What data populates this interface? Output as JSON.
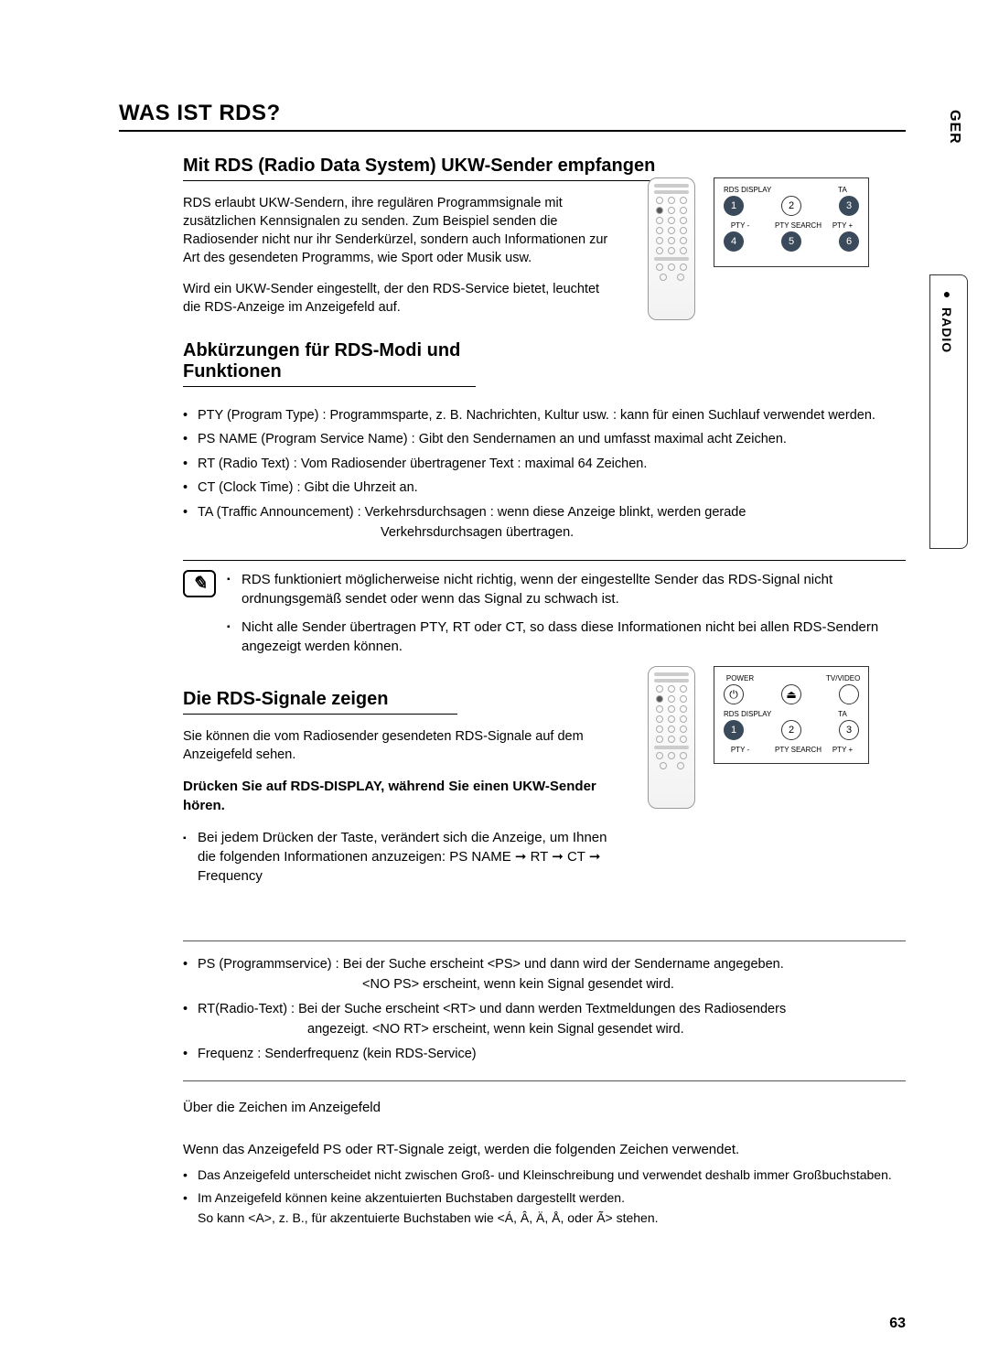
{
  "lang": "GER",
  "sectionTab": "RADIO",
  "pageNumber": "63",
  "title": "WAS IST RDS?",
  "s1": {
    "heading": "Mit RDS (Radio Data System) UKW-Sender empfangen",
    "p1": "RDS erlaubt UKW-Sendern, ihre regulären Programmsignale mit zusätzlichen Kennsignalen zu senden. Zum Beispiel senden die Radiosender nicht nur ihr Senderkürzel, sondern auch Informationen zur Art des gesendeten Programms, wie Sport oder Musik usw.",
    "p2": "Wird ein UKW-Sender eingestellt, der den RDS-Service bietet, leuchtet die RDS-Anzeige im Anzeigefeld auf."
  },
  "s2": {
    "heading": "Abkürzungen für RDS-Modi und Funktionen",
    "b1": "PTY (Program Type) : Programmsparte, z. B. Nachrichten, Kultur usw. : kann für einen Suchlauf verwendet werden.",
    "b2": "PS NAME (Program Service Name) : Gibt den Sendernamen an und umfasst maximal acht Zeichen.",
    "b3": "RT (Radio Text) : Vom Radiosender übertragener Text : maximal 64 Zeichen.",
    "b4": "CT (Clock Time) : Gibt die Uhrzeit an.",
    "b5a": "TA (Traffic Announcement) : Verkehrsdurchsagen : wenn diese Anzeige blinkt, werden gerade",
    "b5b": "Verkehrsdurchsagen übertragen."
  },
  "notes1": {
    "n1": "RDS funktioniert möglicherweise nicht richtig, wenn der eingestellte Sender das RDS-Signal nicht ordnungsgemäß sendet oder wenn das Signal zu schwach ist.",
    "n2": "Nicht alle Sender übertragen PTY, RT oder CT, so dass diese Informationen nicht bei allen RDS-Sendern angezeigt werden können."
  },
  "s3": {
    "heading": "Die RDS-Signale zeigen",
    "p1": "Sie können die vom Radiosender gesendeten RDS-Signale auf dem Anzeigefeld sehen.",
    "bold": "Drücken Sie auf RDS-DISPLAY, während Sie einen UKW-Sender hören.",
    "li1": "Bei jedem Drücken der Taste, verändert sich die An­zeige, um Ihnen die folgenden Informationen anzuzei­gen: PS NAME ➞ RT ➞ CT ➞ Frequency"
  },
  "s4": {
    "b1a": "PS (Programmservice) : Bei der Suche erscheint <PS> und dann wird der Sendername angegeben.",
    "b1b": "<NO PS> erscheint, wenn kein Signal gesendet wird.",
    "b2a": "RT(Radio-Text) : Bei der Suche erscheint <RT> und dann werden Textmeldungen des Radiosenders",
    "b2b": "angezeigt. <NO RT> erscheint, wenn kein Signal gesendet wird.",
    "b3": "Frequenz : Senderfrequenz (kein RDS-Service)"
  },
  "s5": {
    "h": "Über die Zeichen im Anzeigefeld",
    "p": "Wenn das Anzeigefeld PS oder RT-Signale zeigt, werden die folgenden Zeichen verwendet.",
    "b1": "Das Anzeigefeld unterscheidet nicht zwischen Groß- und Kleinschreibung und verwendet deshalb immer Großbuchstaben.",
    "b2a": "Im Anzeigefeld können keine akzentuierten Buchstaben dargestellt werden.",
    "b2b": "So kann <A>, z. B., für akzentuierte Buchstaben wie <Á, Â, Ä, Å,  oder Ã> stehen."
  },
  "diagram1": {
    "row1": {
      "l1": "RDS DISPLAY",
      "l2": "",
      "l3": "TA",
      "n1": "1",
      "n2": "2",
      "n3": "3"
    },
    "row2": {
      "l1": "PTY -",
      "l2": "PTY SEARCH",
      "l3": "PTY +",
      "n1": "4",
      "n2": "5",
      "n3": "6"
    }
  },
  "diagram2": {
    "row1": {
      "l1": "POWER",
      "l2": "",
      "l3": "TV/VIDEO",
      "s1": "⏻",
      "s2": "⏏",
      "s3": ""
    },
    "row2": {
      "l1": "RDS DISPLAY",
      "l2": "",
      "l3": "TA",
      "n1": "1",
      "n2": "2",
      "n3": "3"
    },
    "row3": {
      "l1": "PTY -",
      "l2": "PTY SEARCH",
      "l3": "PTY +"
    }
  }
}
